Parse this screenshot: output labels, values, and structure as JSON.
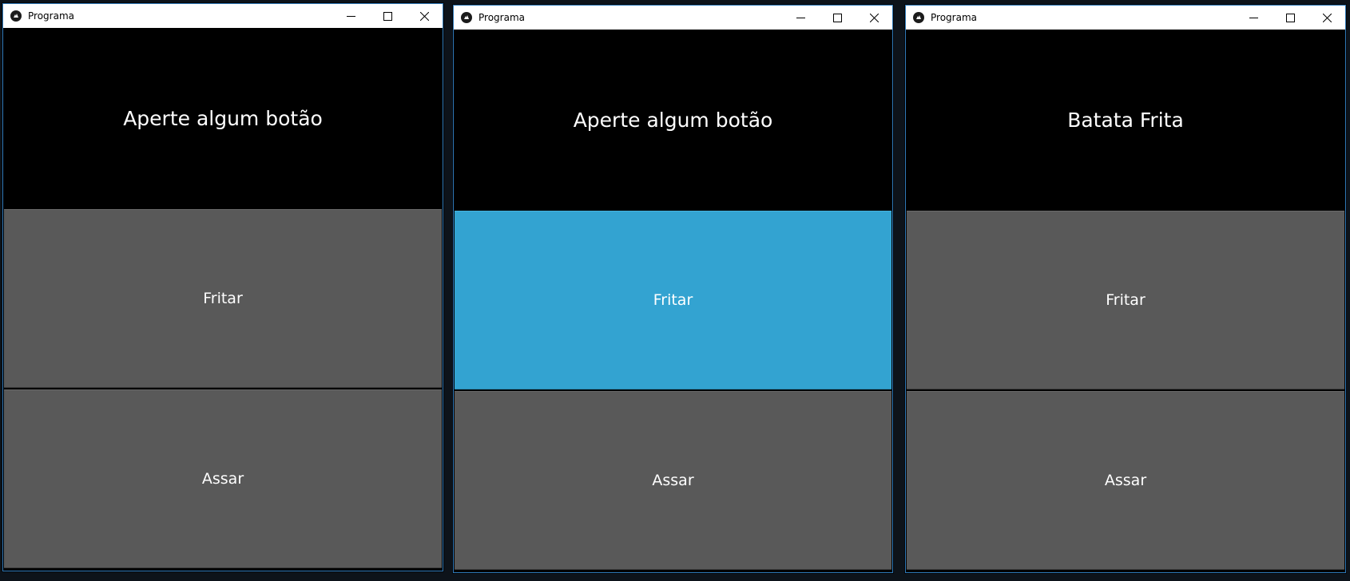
{
  "colors": {
    "titlebar": "#ffffff",
    "window_border": "#2f79b8",
    "content_bg": "#000000",
    "button_bg": "#595959",
    "button_pressed_bg": "#33a3d1",
    "text": "#ffffff"
  },
  "windows": [
    {
      "title": "Programa",
      "label": "Aperte algum botão",
      "buttons": {
        "fritar": "Fritar",
        "assar": "Assar"
      },
      "pressed": "none"
    },
    {
      "title": "Programa",
      "label": "Aperte algum botão",
      "buttons": {
        "fritar": "Fritar",
        "assar": "Assar"
      },
      "pressed": "fritar"
    },
    {
      "title": "Programa",
      "label": "Batata Frita",
      "buttons": {
        "fritar": "Fritar",
        "assar": "Assar"
      },
      "pressed": "none"
    }
  ],
  "icons": {
    "app": "kivy-app-icon",
    "minimize": "minimize-icon",
    "maximize": "maximize-icon",
    "close": "close-icon"
  }
}
